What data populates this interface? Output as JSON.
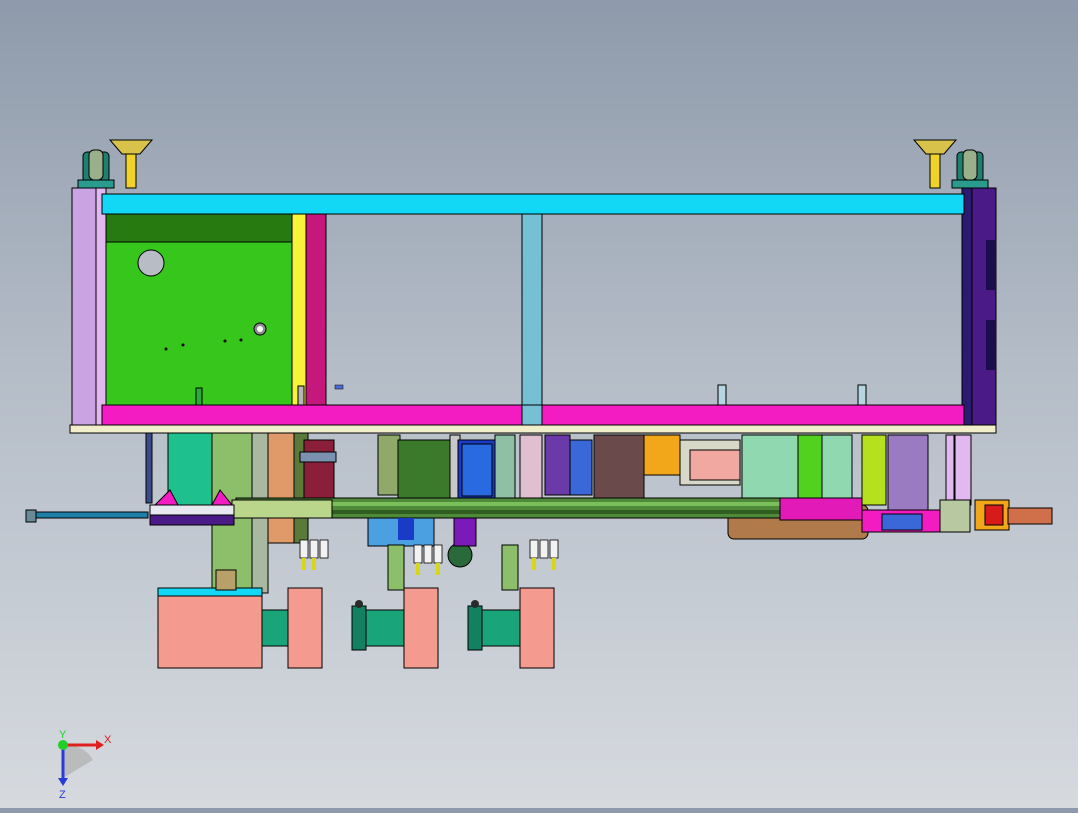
{
  "viewport": {
    "background_top": "#8e9aab",
    "background_bottom": "#d6dadf"
  },
  "triad": {
    "x_label": "X",
    "y_label": "Y",
    "z_label": "Z",
    "x_color": "#e0201e",
    "y_color": "#1fcf2a",
    "z_color": "#2a3ad8"
  },
  "colors": {
    "frame_cyan": "#12d8f5",
    "frame_magenta": "#f21cc2",
    "panel_green": "#36c61c",
    "post_purple": "#4a1a86",
    "post_lavender": "#c9a3e4",
    "salmon": "#f59a8e",
    "teal_motor": "#1aa47a",
    "rail_green": "#4e8a3a"
  }
}
